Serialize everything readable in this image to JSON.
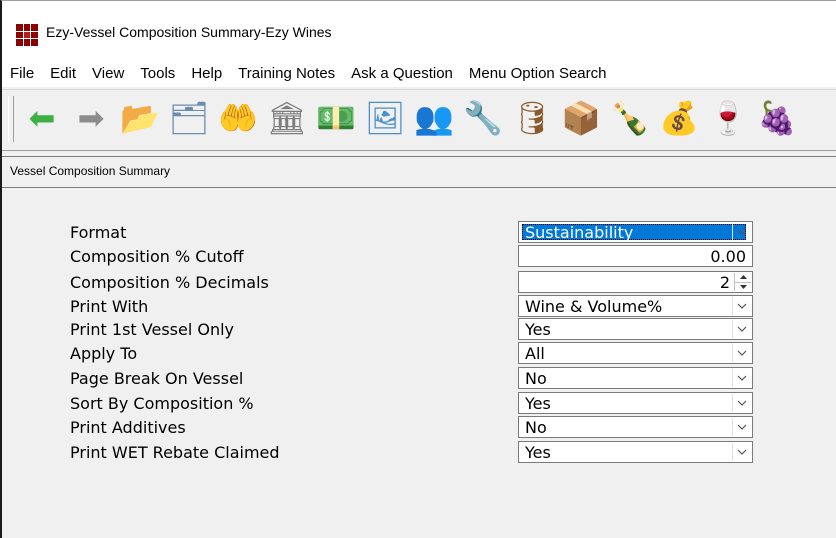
{
  "window": {
    "title": "Ezy-Vessel Composition Summary-Ezy Wines"
  },
  "menu": [
    "File",
    "Edit",
    "View",
    "Tools",
    "Help",
    "Training Notes",
    "Ask a Question",
    "Menu Option Search"
  ],
  "toolbar": {
    "buttons": [
      {
        "name": "back-arrow-icon",
        "glyph": "⬅",
        "color": "#3cb043"
      },
      {
        "name": "forward-arrow-icon",
        "glyph": "➡",
        "color": "#8c8c8c"
      },
      {
        "name": "folder-icon",
        "glyph": "📂",
        "color": "#e6b800"
      },
      {
        "name": "documents-icon",
        "glyph": "🗂",
        "color": "#6a8caf"
      },
      {
        "name": "hand-money-icon",
        "glyph": "🤲",
        "color": "#7cb342"
      },
      {
        "name": "building-icon",
        "glyph": "🏛",
        "color": "#7d7d7d"
      },
      {
        "name": "money-roll-icon",
        "glyph": "💵",
        "color": "#4caf50"
      },
      {
        "name": "stamp-icon",
        "glyph": "🖼",
        "color": "#4a90c8"
      },
      {
        "name": "people-icon",
        "glyph": "👥",
        "color": "#d4a017"
      },
      {
        "name": "wrench-icon",
        "glyph": "🔧",
        "color": "#9e9e9e"
      },
      {
        "name": "barrel-icon",
        "glyph": "🛢",
        "color": "#8b5a2b"
      },
      {
        "name": "box-icon",
        "glyph": "📦",
        "color": "#c8a165"
      },
      {
        "name": "bottling-icon",
        "glyph": "🍾",
        "color": "#9e9e9e"
      },
      {
        "name": "cash-icon",
        "glyph": "💰",
        "color": "#7cb342"
      },
      {
        "name": "wine-icon",
        "glyph": "🍷",
        "color": "#8b0000"
      },
      {
        "name": "grapes-icon",
        "glyph": "🍇",
        "color": "#7b3f8c"
      }
    ]
  },
  "tab": {
    "label": "Vessel Composition Summary"
  },
  "form": {
    "rows": [
      {
        "label": "Format",
        "value": "Sustainability",
        "kind": "select",
        "selected": true
      },
      {
        "label": "Composition % Cutoff",
        "value": "0.00",
        "kind": "number"
      },
      {
        "label": "Composition % Decimals",
        "value": "2",
        "kind": "spin"
      },
      {
        "label": "Print With",
        "value": "Wine & Volume%",
        "kind": "select"
      },
      {
        "label": "Print 1st Vessel Only",
        "value": "Yes",
        "kind": "select"
      },
      {
        "label": "Apply To",
        "value": "All",
        "kind": "select"
      },
      {
        "label": "Page Break On Vessel",
        "value": "No",
        "kind": "select"
      },
      {
        "label": "Sort By Composition %",
        "value": "Yes",
        "kind": "select"
      },
      {
        "label": "Print Additives",
        "value": "No",
        "kind": "select"
      },
      {
        "label": "Print WET Rebate Claimed",
        "value": "Yes",
        "kind": "select"
      }
    ]
  }
}
